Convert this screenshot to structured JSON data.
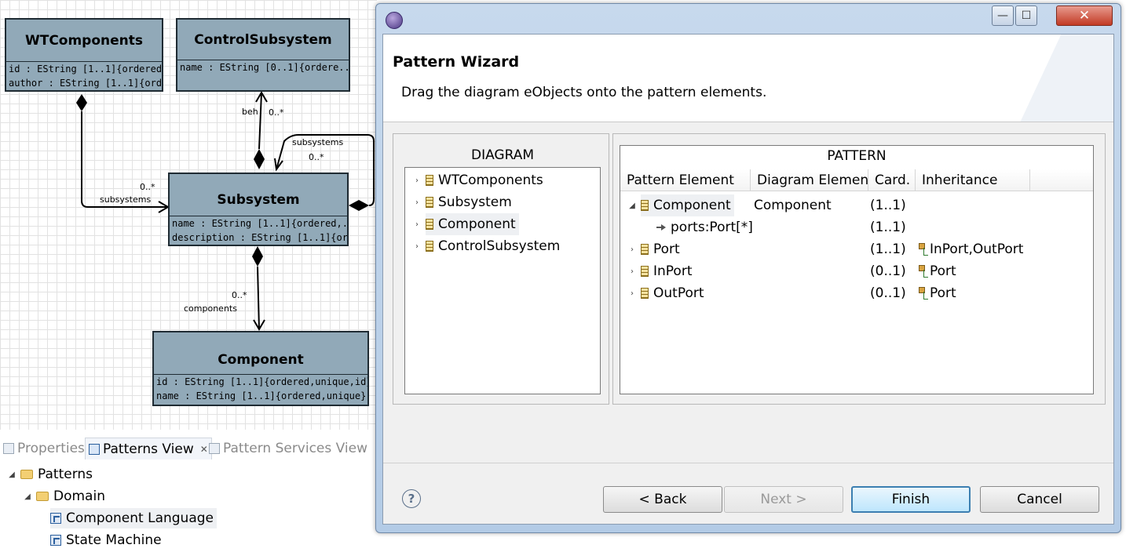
{
  "diagram": {
    "classes": {
      "wtcomponents": {
        "name": "WTComponents",
        "attrs": [
          "id : EString [1..1]{ordered...",
          "author : EString [1..1]{ord..."
        ]
      },
      "control": {
        "name": "ControlSubsystem",
        "attrs": [
          "name : EString [0..1]{ordere..."
        ]
      },
      "subsystem": {
        "name": "Subsystem",
        "attrs": [
          "name : EString [1..1]{ordered,...",
          "description : EString [1..1]{or..."
        ]
      },
      "component": {
        "name": "Component",
        "attrs": [
          "id : EString [1..1]{ordered,unique,id}",
          "name : EString [1..1]{ordered,unique}"
        ]
      }
    },
    "labels": {
      "beh": "beh",
      "beh_card": "0..*",
      "subsystems_self": "subsystems",
      "subsystems_self_card": "0..*",
      "subsystems_wt": "subsystems",
      "subsystems_wt_card": "0..*",
      "components": "components",
      "components_card": "0..*"
    }
  },
  "views": {
    "tabs": [
      "Properties",
      "Patterns View",
      "Pattern Services View"
    ],
    "tree": [
      "Patterns",
      "Domain",
      "Component Language",
      "State Machine"
    ]
  },
  "dialog": {
    "title": "Pattern Wizard",
    "message": "Drag the diagram eObjects onto the pattern elements.",
    "window_controls": {
      "minimize": "—",
      "maximize": "☐",
      "close": "✕"
    },
    "diagram_panel": {
      "title": "DIAGRAM",
      "items": [
        "WTComponents",
        "Subsystem",
        "Component",
        "ControlSubsystem"
      ]
    },
    "pattern_panel": {
      "title": "PATTERN",
      "columns": [
        "Pattern Element",
        "Diagram Element",
        "Card.",
        "Inheritance"
      ],
      "rows": [
        {
          "element": "Component",
          "diagram": "Component",
          "card": "(1..1)",
          "inheritance": ""
        },
        {
          "element": "ports:Port[*]",
          "diagram": "",
          "card": "(1..1)",
          "inheritance": ""
        },
        {
          "element": "Port",
          "diagram": "",
          "card": "(1..1)",
          "inheritance": "InPort,OutPort"
        },
        {
          "element": "InPort",
          "diagram": "",
          "card": "(0..1)",
          "inheritance": "Port"
        },
        {
          "element": "OutPort",
          "diagram": "",
          "card": "(0..1)",
          "inheritance": "Port"
        }
      ]
    },
    "buttons": {
      "help": "?",
      "back": "< Back",
      "next": "Next >",
      "finish": "Finish",
      "cancel": "Cancel"
    }
  }
}
